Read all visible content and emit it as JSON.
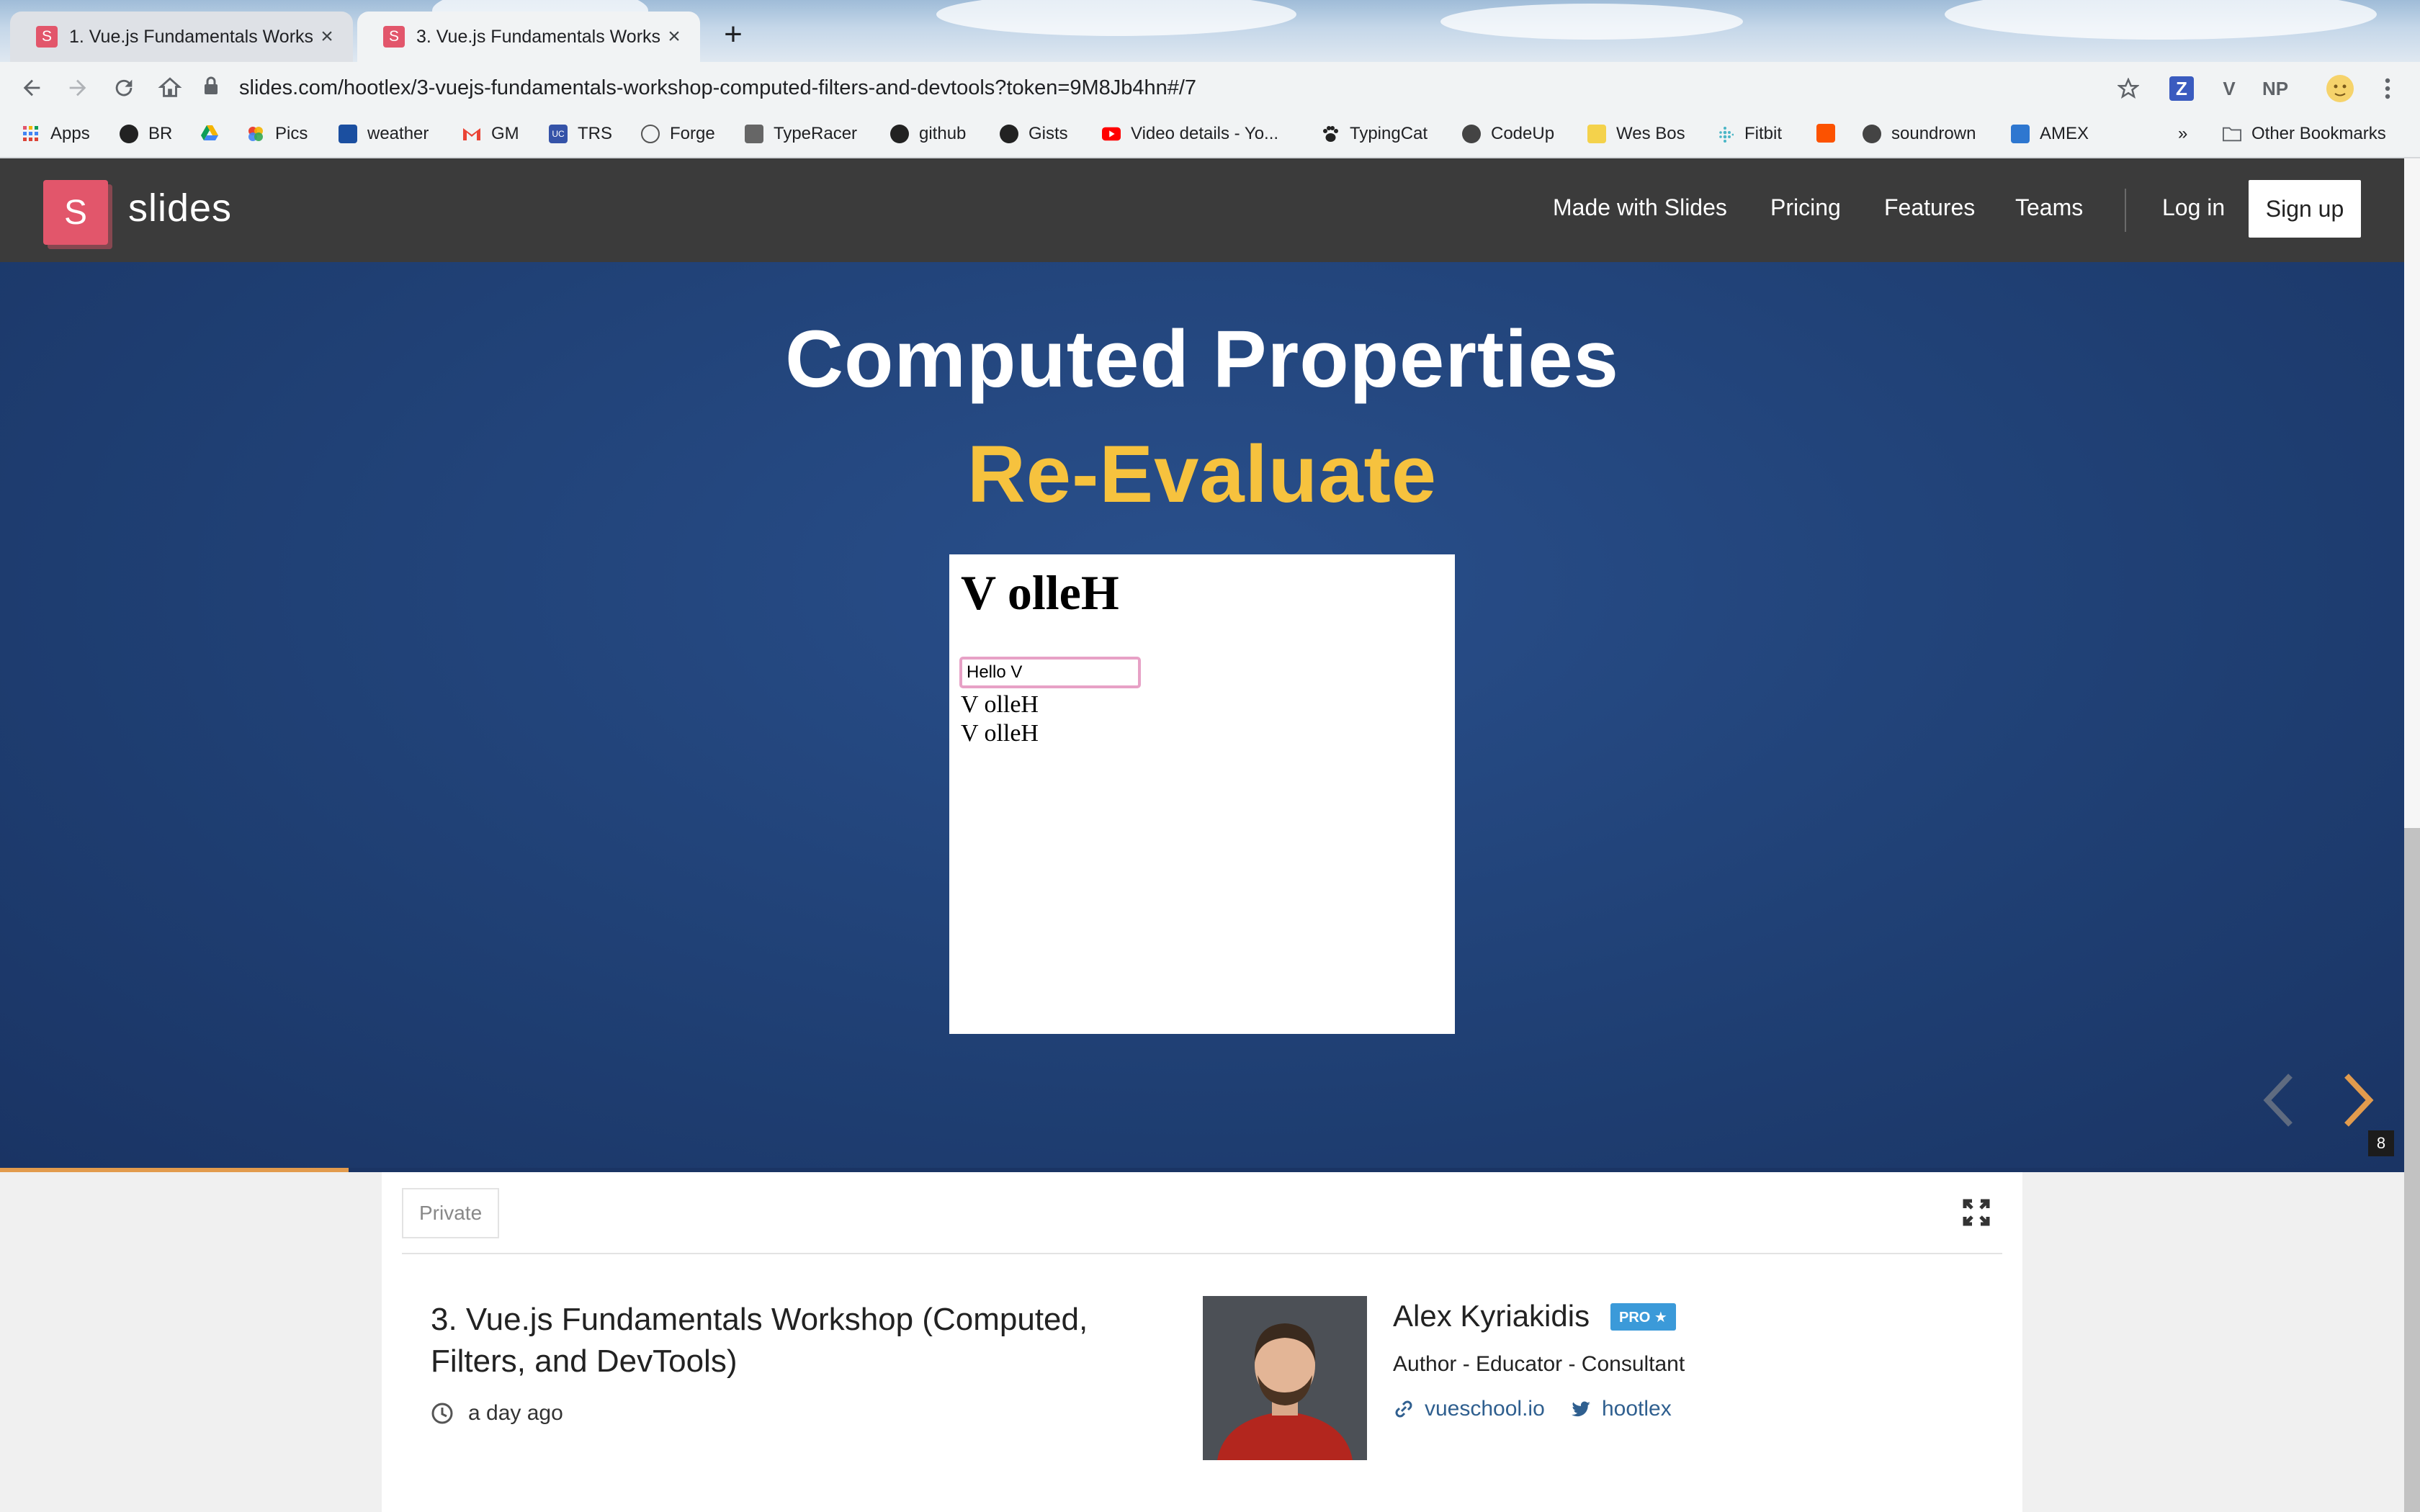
{
  "browser": {
    "tabs": [
      {
        "favicon": "S",
        "title": "1. Vue.js Fundamentals Workshop (Computed, Filters, and DevTools)",
        "close": "×"
      },
      {
        "favicon": "S",
        "title": "3. Vue.js Fundamentals Workshop (Computed, Filters, and DevTools)",
        "close": "×"
      }
    ],
    "new_tab": "+",
    "url": "slides.com/hootlex/3-vuejs-fundamentals-workshop-computed-filters-and-devtools?token=9M8Jb4hn#/7",
    "extensions": [
      "Z",
      "V",
      "NP"
    ],
    "bookmarks": [
      {
        "label": "Apps",
        "icon": "apps-grid-icon"
      },
      {
        "label": "BR",
        "icon": "github-icon"
      },
      {
        "label": "",
        "icon": "google-drive-icon"
      },
      {
        "label": "Pics",
        "icon": "google-photos-icon"
      },
      {
        "label": "weather",
        "icon": "weather-icon"
      },
      {
        "label": "GM",
        "icon": "gmail-icon"
      },
      {
        "label": "TRS",
        "icon": "trs-icon"
      },
      {
        "label": "Forge",
        "icon": "forge-icon"
      },
      {
        "label": "TypeRacer",
        "icon": "typeracer-icon"
      },
      {
        "label": "github",
        "icon": "github-icon"
      },
      {
        "label": "Gists",
        "icon": "github-icon"
      },
      {
        "label": "Video details - Yo...",
        "icon": "youtube-icon"
      },
      {
        "label": "TypingCat",
        "icon": "paw-icon"
      },
      {
        "label": "CodeUp",
        "icon": "globe-icon"
      },
      {
        "label": "Wes Bos",
        "icon": "crown-icon"
      },
      {
        "label": "Fitbit",
        "icon": "fitbit-icon"
      },
      {
        "label": "",
        "icon": "strava-icon"
      },
      {
        "label": "soundrown",
        "icon": "globe-icon"
      },
      {
        "label": "AMEX",
        "icon": "amex-icon"
      }
    ],
    "more_bookmarks": "»",
    "other_bookmarks": "Other Bookmarks"
  },
  "site": {
    "logo_letter": "S",
    "logo_text": "slides",
    "nav": [
      "Made with Slides",
      "Pricing",
      "Features",
      "Teams"
    ],
    "login": "Log in",
    "signup": "Sign up"
  },
  "slide": {
    "title": "Computed Properties",
    "subtitle": "Re-Evaluate",
    "demo": {
      "heading": "V olleH",
      "input_value": "Hello V",
      "lines": [
        "V olleH",
        "V olleH"
      ]
    },
    "prev_arrow": "‹",
    "next_arrow": "›",
    "counter": "8",
    "progress": 0.145
  },
  "deck": {
    "visibility": "Private",
    "title": "3. Vue.js Fundamentals Workshop (Computed, Filters, and DevTools)",
    "time": "a day ago",
    "author": {
      "name": "Alex Kyriakidis",
      "badge": "PRO ★",
      "role": "Author - Educator - Consultant",
      "website": "vueschool.io",
      "twitter": "hootlex"
    }
  },
  "colors": {
    "brand": "#e2566b",
    "slide_bg": "#1f3f73",
    "subtitle": "#f6c23e",
    "next_arrow": "#e29b4d",
    "pro_badge": "#3b9ad9",
    "link": "#2f5f8f"
  }
}
